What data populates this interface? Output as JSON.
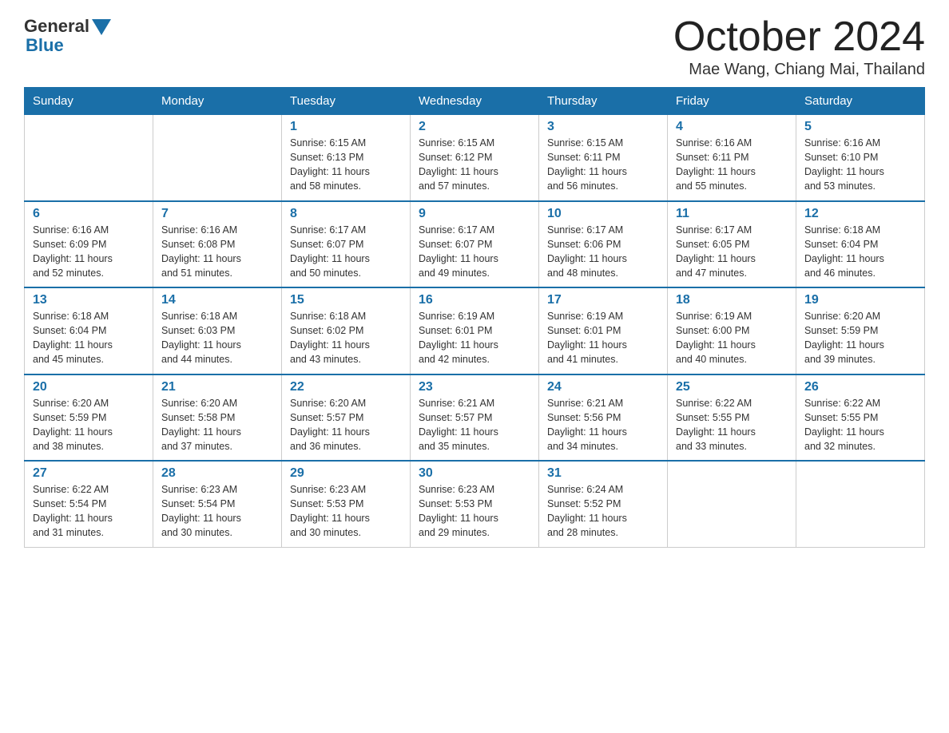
{
  "logo": {
    "general": "General",
    "blue": "Blue"
  },
  "title": "October 2024",
  "location": "Mae Wang, Chiang Mai, Thailand",
  "days_of_week": [
    "Sunday",
    "Monday",
    "Tuesday",
    "Wednesday",
    "Thursday",
    "Friday",
    "Saturday"
  ],
  "weeks": [
    [
      {
        "day": "",
        "info": ""
      },
      {
        "day": "",
        "info": ""
      },
      {
        "day": "1",
        "info": "Sunrise: 6:15 AM\nSunset: 6:13 PM\nDaylight: 11 hours\nand 58 minutes."
      },
      {
        "day": "2",
        "info": "Sunrise: 6:15 AM\nSunset: 6:12 PM\nDaylight: 11 hours\nand 57 minutes."
      },
      {
        "day": "3",
        "info": "Sunrise: 6:15 AM\nSunset: 6:11 PM\nDaylight: 11 hours\nand 56 minutes."
      },
      {
        "day": "4",
        "info": "Sunrise: 6:16 AM\nSunset: 6:11 PM\nDaylight: 11 hours\nand 55 minutes."
      },
      {
        "day": "5",
        "info": "Sunrise: 6:16 AM\nSunset: 6:10 PM\nDaylight: 11 hours\nand 53 minutes."
      }
    ],
    [
      {
        "day": "6",
        "info": "Sunrise: 6:16 AM\nSunset: 6:09 PM\nDaylight: 11 hours\nand 52 minutes."
      },
      {
        "day": "7",
        "info": "Sunrise: 6:16 AM\nSunset: 6:08 PM\nDaylight: 11 hours\nand 51 minutes."
      },
      {
        "day": "8",
        "info": "Sunrise: 6:17 AM\nSunset: 6:07 PM\nDaylight: 11 hours\nand 50 minutes."
      },
      {
        "day": "9",
        "info": "Sunrise: 6:17 AM\nSunset: 6:07 PM\nDaylight: 11 hours\nand 49 minutes."
      },
      {
        "day": "10",
        "info": "Sunrise: 6:17 AM\nSunset: 6:06 PM\nDaylight: 11 hours\nand 48 minutes."
      },
      {
        "day": "11",
        "info": "Sunrise: 6:17 AM\nSunset: 6:05 PM\nDaylight: 11 hours\nand 47 minutes."
      },
      {
        "day": "12",
        "info": "Sunrise: 6:18 AM\nSunset: 6:04 PM\nDaylight: 11 hours\nand 46 minutes."
      }
    ],
    [
      {
        "day": "13",
        "info": "Sunrise: 6:18 AM\nSunset: 6:04 PM\nDaylight: 11 hours\nand 45 minutes."
      },
      {
        "day": "14",
        "info": "Sunrise: 6:18 AM\nSunset: 6:03 PM\nDaylight: 11 hours\nand 44 minutes."
      },
      {
        "day": "15",
        "info": "Sunrise: 6:18 AM\nSunset: 6:02 PM\nDaylight: 11 hours\nand 43 minutes."
      },
      {
        "day": "16",
        "info": "Sunrise: 6:19 AM\nSunset: 6:01 PM\nDaylight: 11 hours\nand 42 minutes."
      },
      {
        "day": "17",
        "info": "Sunrise: 6:19 AM\nSunset: 6:01 PM\nDaylight: 11 hours\nand 41 minutes."
      },
      {
        "day": "18",
        "info": "Sunrise: 6:19 AM\nSunset: 6:00 PM\nDaylight: 11 hours\nand 40 minutes."
      },
      {
        "day": "19",
        "info": "Sunrise: 6:20 AM\nSunset: 5:59 PM\nDaylight: 11 hours\nand 39 minutes."
      }
    ],
    [
      {
        "day": "20",
        "info": "Sunrise: 6:20 AM\nSunset: 5:59 PM\nDaylight: 11 hours\nand 38 minutes."
      },
      {
        "day": "21",
        "info": "Sunrise: 6:20 AM\nSunset: 5:58 PM\nDaylight: 11 hours\nand 37 minutes."
      },
      {
        "day": "22",
        "info": "Sunrise: 6:20 AM\nSunset: 5:57 PM\nDaylight: 11 hours\nand 36 minutes."
      },
      {
        "day": "23",
        "info": "Sunrise: 6:21 AM\nSunset: 5:57 PM\nDaylight: 11 hours\nand 35 minutes."
      },
      {
        "day": "24",
        "info": "Sunrise: 6:21 AM\nSunset: 5:56 PM\nDaylight: 11 hours\nand 34 minutes."
      },
      {
        "day": "25",
        "info": "Sunrise: 6:22 AM\nSunset: 5:55 PM\nDaylight: 11 hours\nand 33 minutes."
      },
      {
        "day": "26",
        "info": "Sunrise: 6:22 AM\nSunset: 5:55 PM\nDaylight: 11 hours\nand 32 minutes."
      }
    ],
    [
      {
        "day": "27",
        "info": "Sunrise: 6:22 AM\nSunset: 5:54 PM\nDaylight: 11 hours\nand 31 minutes."
      },
      {
        "day": "28",
        "info": "Sunrise: 6:23 AM\nSunset: 5:54 PM\nDaylight: 11 hours\nand 30 minutes."
      },
      {
        "day": "29",
        "info": "Sunrise: 6:23 AM\nSunset: 5:53 PM\nDaylight: 11 hours\nand 30 minutes."
      },
      {
        "day": "30",
        "info": "Sunrise: 6:23 AM\nSunset: 5:53 PM\nDaylight: 11 hours\nand 29 minutes."
      },
      {
        "day": "31",
        "info": "Sunrise: 6:24 AM\nSunset: 5:52 PM\nDaylight: 11 hours\nand 28 minutes."
      },
      {
        "day": "",
        "info": ""
      },
      {
        "day": "",
        "info": ""
      }
    ]
  ]
}
